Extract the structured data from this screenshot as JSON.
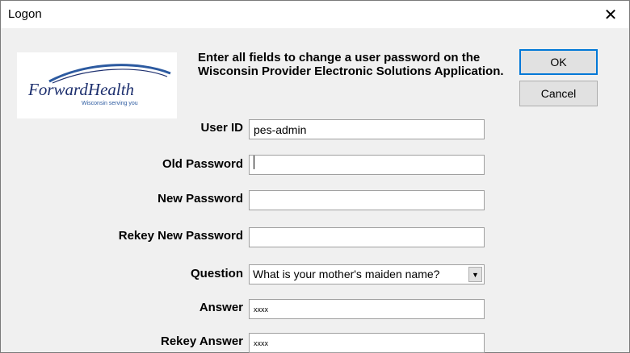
{
  "window": {
    "title": "Logon",
    "close_glyph": "✕"
  },
  "logo": {
    "name": "ForwardHealth",
    "tagline": "Wisconsin serving you"
  },
  "instructions": "Enter all fields to change a user password on the Wisconsin Provider Electronic Solutions Application.",
  "buttons": {
    "ok": "OK",
    "cancel": "Cancel"
  },
  "form": {
    "user_id_label": "User ID",
    "user_id_value": "pes-admin",
    "old_password_label": "Old Password",
    "old_password_value": "",
    "new_password_label": "New Password",
    "new_password_value": "",
    "rekey_new_password_label": "Rekey New Password",
    "rekey_new_password_value": "",
    "question_label": "Question",
    "question_value": "What is your mother's maiden name?",
    "answer_label": "Answer",
    "answer_value": "xxxx",
    "rekey_answer_label": "Rekey Answer",
    "rekey_answer_value": "xxxx"
  },
  "icons": {
    "close": "close-icon",
    "dropdown": "chevron-down-icon"
  },
  "colors": {
    "dialog_bg": "#f0f0f0",
    "default_button_border": "#0078d7",
    "logo_navy": "#1d2f6e",
    "logo_blue": "#2c5aa0"
  }
}
